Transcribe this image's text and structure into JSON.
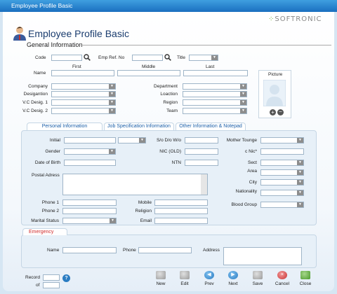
{
  "window": {
    "title": "Employee Profile Basic"
  },
  "brand": {
    "name": "SOFTRONIC",
    "mark": "⁘"
  },
  "header": {
    "title": "Employee Profile Basic",
    "section": "General Information"
  },
  "general": {
    "code_label": "Code",
    "emp_ref_label": "Emp Ref. No",
    "title_label": "Title",
    "name_label": "Name",
    "first_label": "First",
    "middle_label": "Middle",
    "last_label": "Last",
    "company_label": "Company",
    "designation_label": "Desigantion",
    "vc1_label": "V.C Desig. 1",
    "vc2_label": "V.C Desig. 2",
    "department_label": "Department",
    "location_label": "Loaction",
    "region_label": "Region",
    "team_label": "Team",
    "picture_label": "Picture"
  },
  "tabs": [
    {
      "label": "Personal Information",
      "active": true
    },
    {
      "label": "Job Specification Information",
      "active": false
    },
    {
      "label": "Other Information & Notepad",
      "active": false
    }
  ],
  "personal": {
    "initial_label": "Initial",
    "so_label": "S/o D/o W/o",
    "mother_tongue_label": "Mother Tounge",
    "gender_label": "Gender",
    "nic_old_label": "NIC (OLD)",
    "cnic_label": "c Nic*",
    "dob_label": "Date of Birth",
    "ntn_label": "NTN",
    "sect_label": "Sect",
    "postal_label": "Postal Adress",
    "area_label": "Area",
    "city_label": "City",
    "nationality_label": "Nationality",
    "phone1_label": "Phone 1",
    "mobile_label": "Mobile",
    "blood_group_label": "Blood Group",
    "phone2_label": "Phone 2",
    "religion_label": "Religion",
    "marital_label": "Marital Status",
    "email_label": "Email"
  },
  "emergency": {
    "tab_label": "Emergency",
    "name_label": "Name",
    "phone_label": "Phone",
    "address_label": "Address"
  },
  "footer": {
    "record_label": "Record",
    "of_label": "of",
    "help_icon": "?"
  },
  "toolbar": {
    "new": "New",
    "edit": "Edit",
    "prev": "Prev",
    "next": "Next",
    "save": "Save",
    "cancel": "Cancel",
    "close": "Close"
  },
  "colors": {
    "title_blue": "#1a6fbf",
    "tab_text": "#1a5ea8",
    "emergency_red": "#d02b2b"
  }
}
